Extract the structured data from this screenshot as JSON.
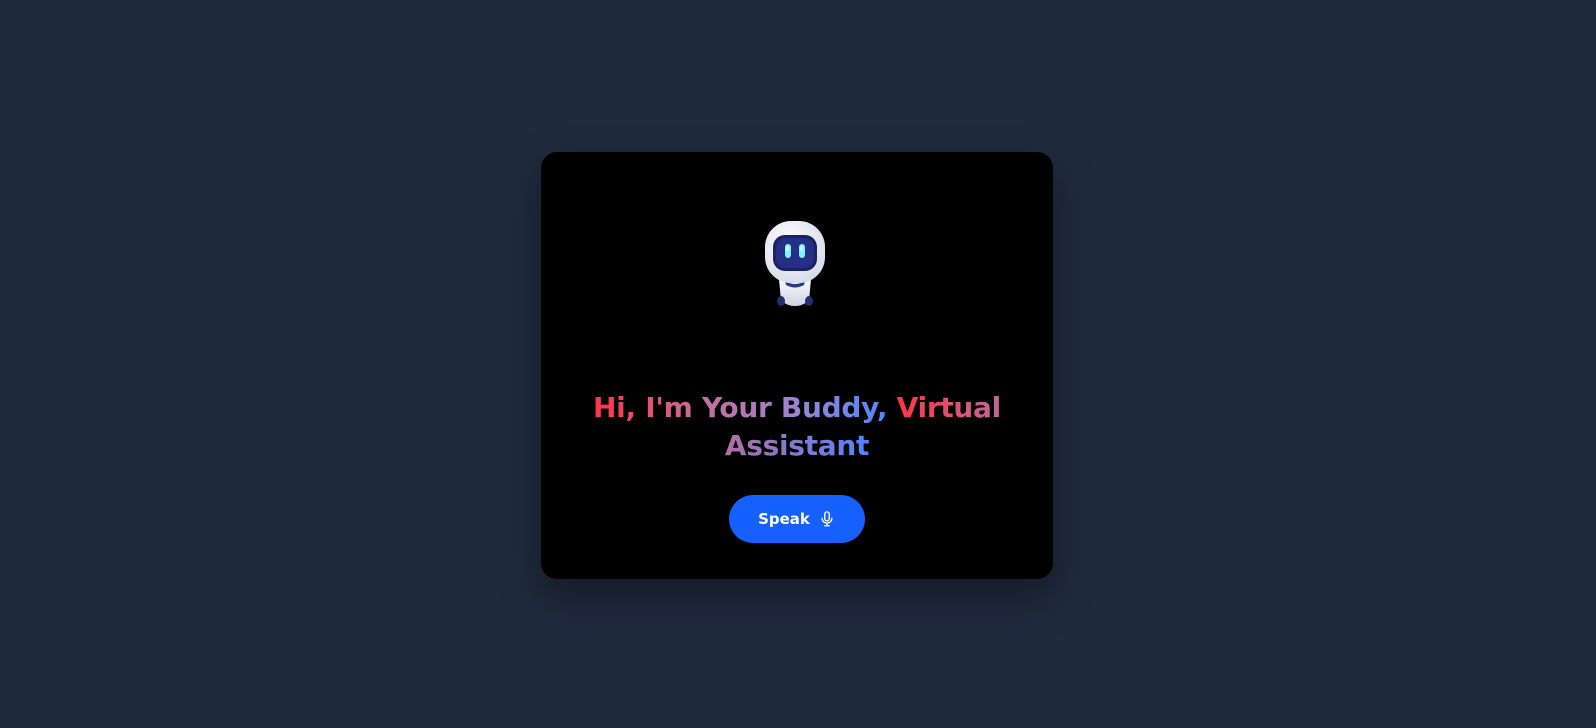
{
  "assistant": {
    "headline_line1_part1": "Hi, I'm Your Buddy,",
    "headline_line1_part2": "Virtual",
    "headline_line2": "Assistant",
    "speak_button_label": "Speak",
    "mic_icon": "microphone-icon",
    "robot_icon": "robot-avatar"
  },
  "colors": {
    "page_background": "#1f2a3c",
    "card_background": "#000000",
    "button_background": "#1560ff",
    "gradient_red": "#ff3446",
    "gradient_blue": "#4d86ff"
  }
}
